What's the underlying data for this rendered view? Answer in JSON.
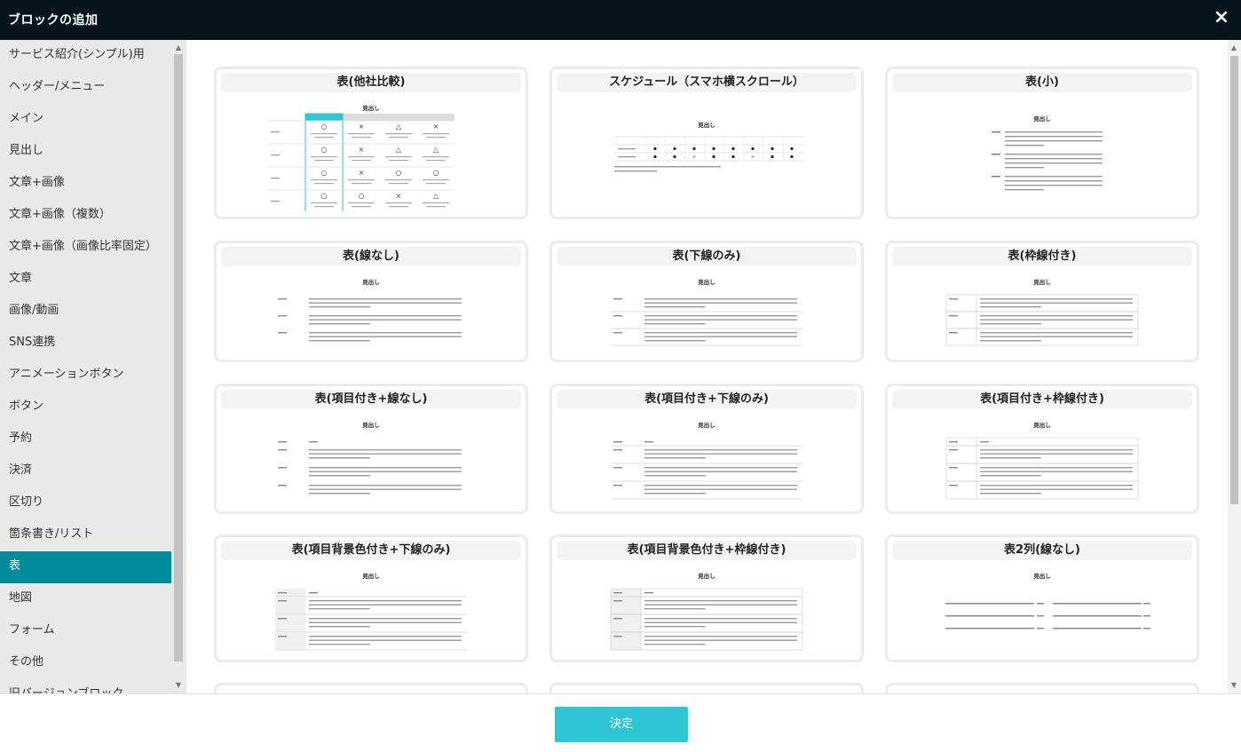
{
  "dialog": {
    "title": "ブロックの追加",
    "close_icon": "×",
    "confirm_label": "決定",
    "accent": "#008c9a",
    "confirm_color": "#2ec6d5"
  },
  "sidebar": {
    "items": [
      {
        "label": "サービス紹介(シンプル)用",
        "active": false
      },
      {
        "label": "ヘッダー/メニュー",
        "active": false
      },
      {
        "label": "メイン",
        "active": false
      },
      {
        "label": "見出し",
        "active": false
      },
      {
        "label": "文章+画像",
        "active": false
      },
      {
        "label": "文章+画像（複数）",
        "active": false
      },
      {
        "label": "文章+画像（画像比率固定）",
        "active": false
      },
      {
        "label": "文章",
        "active": false
      },
      {
        "label": "画像/動画",
        "active": false
      },
      {
        "label": "SNS連携",
        "active": false
      },
      {
        "label": "アニメーションボタン",
        "active": false
      },
      {
        "label": "ボタン",
        "active": false
      },
      {
        "label": "予約",
        "active": false
      },
      {
        "label": "決済",
        "active": false
      },
      {
        "label": "区切り",
        "active": false
      },
      {
        "label": "箇条書き/リスト",
        "active": false
      },
      {
        "label": "表",
        "active": true
      },
      {
        "label": "地図",
        "active": false
      },
      {
        "label": "フォーム",
        "active": false
      },
      {
        "label": "その他",
        "active": false
      },
      {
        "label": "旧バージョンブロック",
        "active": false
      }
    ]
  },
  "blocks": [
    {
      "title": "表(他社比較)",
      "preview": "compare",
      "heading": "見出し"
    },
    {
      "title": "スケジュール（スマホ横スクロール）",
      "preview": "schedule",
      "heading": "見出し"
    },
    {
      "title": "表(小)",
      "preview": "small",
      "heading": "見出し"
    },
    {
      "title": "表(線なし)",
      "preview": "table-none",
      "heading": "見出し"
    },
    {
      "title": "表(下線のみ)",
      "preview": "table-under",
      "heading": "見出し"
    },
    {
      "title": "表(枠線付き)",
      "preview": "table-border",
      "heading": "見出し"
    },
    {
      "title": "表(項目付き+線なし)",
      "preview": "table-none-header",
      "heading": "見出し"
    },
    {
      "title": "表(項目付き+下線のみ)",
      "preview": "table-under-header",
      "heading": "見出し"
    },
    {
      "title": "表(項目付き+枠線付き)",
      "preview": "table-border-header",
      "heading": "見出し"
    },
    {
      "title": "表(項目背景色付き+下線のみ)",
      "preview": "table-under-bg",
      "heading": "見出し"
    },
    {
      "title": "表(項目背景色付き+枠線付き)",
      "preview": "table-border-bg",
      "heading": "見出し"
    },
    {
      "title": "表2列(線なし)",
      "preview": "two-col",
      "heading": "見出し"
    }
  ]
}
